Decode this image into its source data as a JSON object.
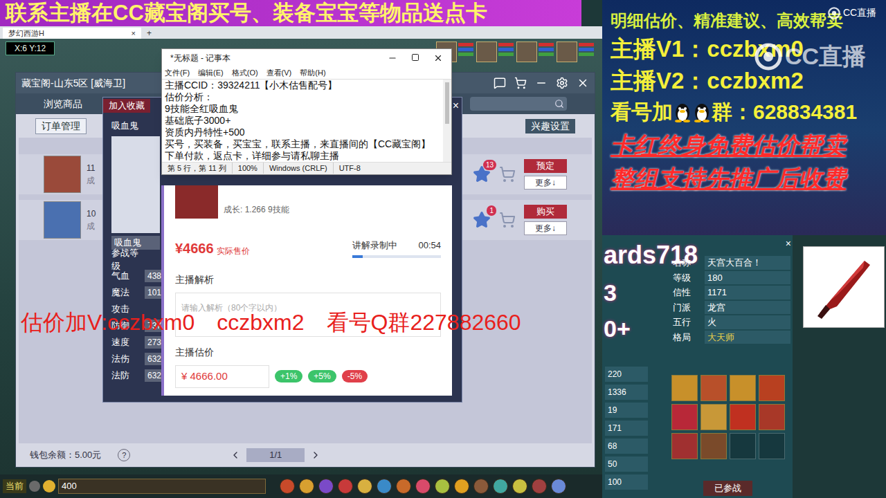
{
  "stream_banner": {
    "text": "联系主播在CC藏宝阁买号、装备宝宝等物品送点卡"
  },
  "watermark": "CC直播",
  "game_client": {
    "tab_title": "梦幻西游H",
    "tab_close": "×",
    "tab_add": "+",
    "coords": "X:6  Y:12"
  },
  "cbg_window": {
    "title": "藏宝阁-山东5区 [威海卫]",
    "nav": [
      "浏览商品"
    ],
    "toolbar_left": "订单管理",
    "toolbar_right": "兴趣设置",
    "rows": [
      {
        "level": "11",
        "sub": "成",
        "star_count": "13",
        "action": "预定",
        "more": "更多↓"
      },
      {
        "level": "10",
        "sub": "成",
        "star_count": "1",
        "action": "购买",
        "more": "更多↓"
      }
    ],
    "wallet": "钱包余额：5.00元",
    "help": "?",
    "page": "1/1"
  },
  "pet_detail": {
    "header": "加入收藏",
    "name": "吸血鬼",
    "close": "×",
    "name_tag": "吸血鬼",
    "stats": [
      {
        "label": "参战等级",
        "value": ""
      },
      {
        "label": "气血",
        "value": "438"
      },
      {
        "label": "魔法",
        "value": "101"
      },
      {
        "label": "攻击",
        "value": ""
      },
      {
        "label": "防御",
        "value": "737"
      },
      {
        "label": "速度",
        "value": "273"
      },
      {
        "label": "法伤",
        "value": "632"
      },
      {
        "label": "法防",
        "value": "632"
      }
    ]
  },
  "pricing_panel": {
    "growth": "成长: 1.266 9技能",
    "price": "¥4666",
    "price_label": "实际售价",
    "recording": "讲解录制中",
    "timer": "00:54",
    "level": 0.12,
    "analysis_title": "主播解析",
    "analysis_placeholder": "请输入解析（80个字以内）",
    "estimate_title": "主播估价",
    "estimate_value": "¥ 4666.00",
    "adjust": [
      {
        "label": "+1%",
        "color": "#3cc46a"
      },
      {
        "label": "+5%",
        "color": "#3cc46a"
      },
      {
        "label": "-5%",
        "color": "#e0404a"
      }
    ]
  },
  "notepad": {
    "title": "*无标题 - 记事本",
    "menus": [
      "文件(F)",
      "编辑(E)",
      "格式(O)",
      "查看(V)",
      "帮助(H)"
    ],
    "lines": [
      "主播CCID：39324211【小木估售配号】",
      "估价分析：",
      "9技能全红吸血鬼",
      "基础底子3000+",
      "资质内丹特性+500",
      "买号，买装备，买宝宝，联系主播，来直播间的【CC藏宝阁】下单付款，返点卡，详细参与请私聊主播"
    ],
    "status": [
      "第 5 行，第 11 列",
      "100%",
      "Windows (CRLF)",
      "UTF-8"
    ]
  },
  "red_overlay": [
    "估价加V:cczbxm0",
    "cczbxm2",
    "看号Q群227882660"
  ],
  "side_ad": {
    "slogan": "明细估价、精准建议、高效帮卖",
    "v1": "主播V1：cczbxm0",
    "v2": "主播V2：cczbxm2",
    "qq_before": "看号加",
    "qq_after": "群：628834381",
    "red_lines": [
      "卡红终身免费估价帮卖",
      "整组支持先推广后收费"
    ]
  },
  "character_panel": {
    "name_fragment": "ards718",
    "big_a": "3",
    "big_b": "0+",
    "close": "×",
    "fields": [
      {
        "label": "名称",
        "value": "天宫大百合！"
      },
      {
        "label": "等级",
        "value": "180"
      },
      {
        "label": "信性",
        "value": "1171"
      },
      {
        "label": "门派",
        "value": "龙宫"
      },
      {
        "label": "五行",
        "value": "火"
      },
      {
        "label": "格局",
        "value": "大天师"
      }
    ],
    "numbers": [
      "220",
      "1336",
      "19",
      "171",
      "68",
      "50",
      "100"
    ],
    "skills": [
      {
        "color": "#c8902a"
      },
      {
        "color": "#b8502a"
      },
      {
        "color": "#c8902a"
      },
      {
        "color": "#b84020"
      },
      {
        "color": "#b82838"
      },
      {
        "color": "#c89838"
      },
      {
        "color": "#c03020"
      },
      {
        "color": "#a83828"
      },
      {
        "color": "#a03030"
      },
      {
        "color": "#7a4a2a"
      }
    ],
    "battle_button": "已参战"
  },
  "chat_bar": {
    "channel": "当前",
    "input": "400"
  }
}
